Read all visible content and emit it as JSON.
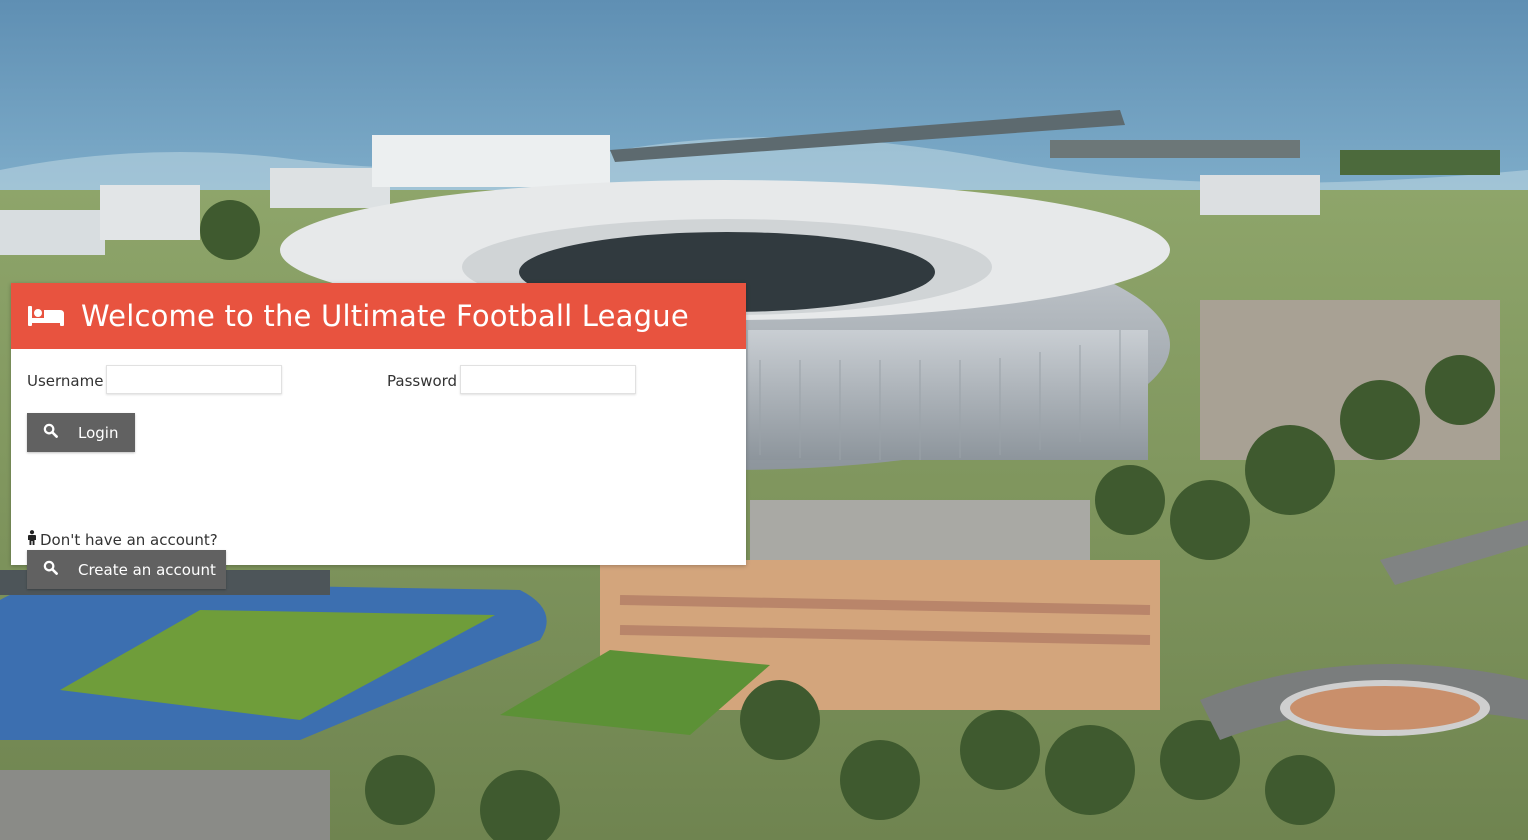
{
  "header": {
    "icon": "bed-icon",
    "title": "Welcome to the Ultimate Football League"
  },
  "login_form": {
    "username_label": "Username",
    "username_value": "",
    "password_label": "Password",
    "password_value": "",
    "login_button": {
      "label": "Login",
      "icon": "search-icon"
    }
  },
  "signup": {
    "prompt_icon": "person-icon",
    "prompt": "Don't have an account?",
    "create_button": {
      "label": "Create an account",
      "icon": "search-icon"
    }
  },
  "colors": {
    "header_bg": "#e8533f",
    "button_bg": "#616161",
    "panel_bg": "#ffffff"
  }
}
